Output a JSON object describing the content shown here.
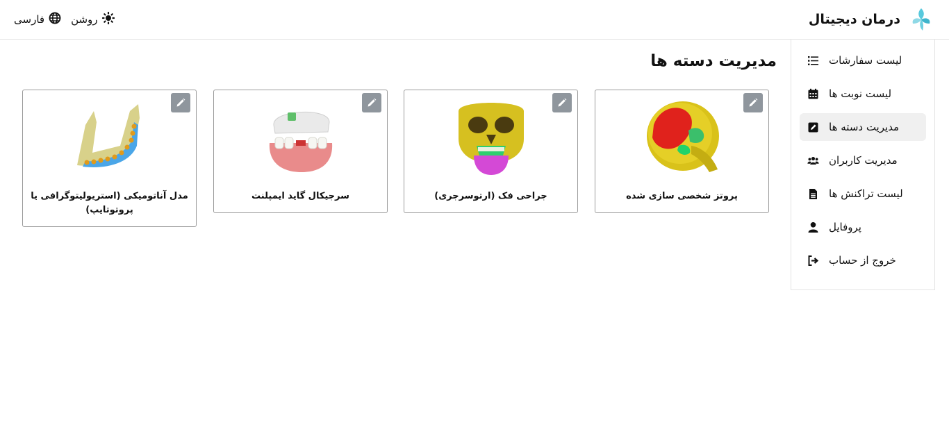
{
  "header": {
    "brand_title": "درمان دیجیتال",
    "theme_label": "روشن",
    "language_label": "فارسی"
  },
  "sidebar": {
    "items": [
      {
        "label": "لیست سفارشات",
        "icon": "list-icon"
      },
      {
        "label": "لیست نوبت ها",
        "icon": "calendar-icon"
      },
      {
        "label": "مدیریت دسته ها",
        "icon": "edit-square-icon",
        "active": true
      },
      {
        "label": "مدیریت کاربران",
        "icon": "users-icon"
      },
      {
        "label": "لیست تراکنش ها",
        "icon": "document-icon"
      },
      {
        "label": "پروفایل",
        "icon": "user-icon"
      },
      {
        "label": "خروج از حساب",
        "icon": "logout-icon"
      }
    ]
  },
  "main": {
    "title": "مدیریت دسته ها",
    "categories": [
      {
        "label": "پروتز شخصی سازی شده",
        "image": "skull-implant-image"
      },
      {
        "label": "جراحی فک (ارتوسرجری)",
        "image": "jaw-surgery-skull-image"
      },
      {
        "label": "سرجیکال گاید ایمپلنت",
        "image": "dental-guide-image"
      },
      {
        "label": "مدل آناتومیکی (استریولیتوگرافی یا پروتوتایپ)",
        "image": "mandible-model-image"
      }
    ]
  },
  "colors": {
    "border": "#e3e3e3",
    "card_border": "#9a9a9a",
    "edit_button": "#8f969d",
    "active_item": "#f0f0f0",
    "logo_blue": "#4fc3d9"
  }
}
